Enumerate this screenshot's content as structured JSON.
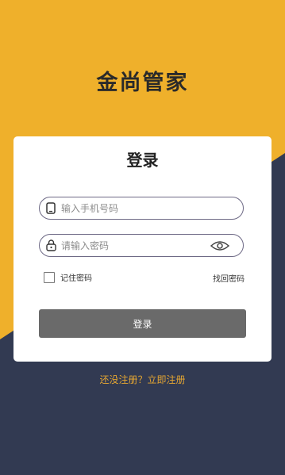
{
  "app": {
    "title": "金尚管家"
  },
  "colors": {
    "top_background": "#efb02b",
    "bottom_background": "#323a52",
    "accent": "#e4a532",
    "button": "#6a6a6a"
  },
  "login_card": {
    "title": "登录",
    "phone_placeholder": "输入手机号码",
    "phone_icon": "phone-icon",
    "password_placeholder": "请输入密码",
    "password_icon": "lock-icon",
    "visibility_icon": "eye-icon",
    "remember_label": "记住密码",
    "remember_checked": false,
    "find_password": "找回密码",
    "login_button": "登录"
  },
  "footer": {
    "register_link": "还没注册？立即注册"
  }
}
